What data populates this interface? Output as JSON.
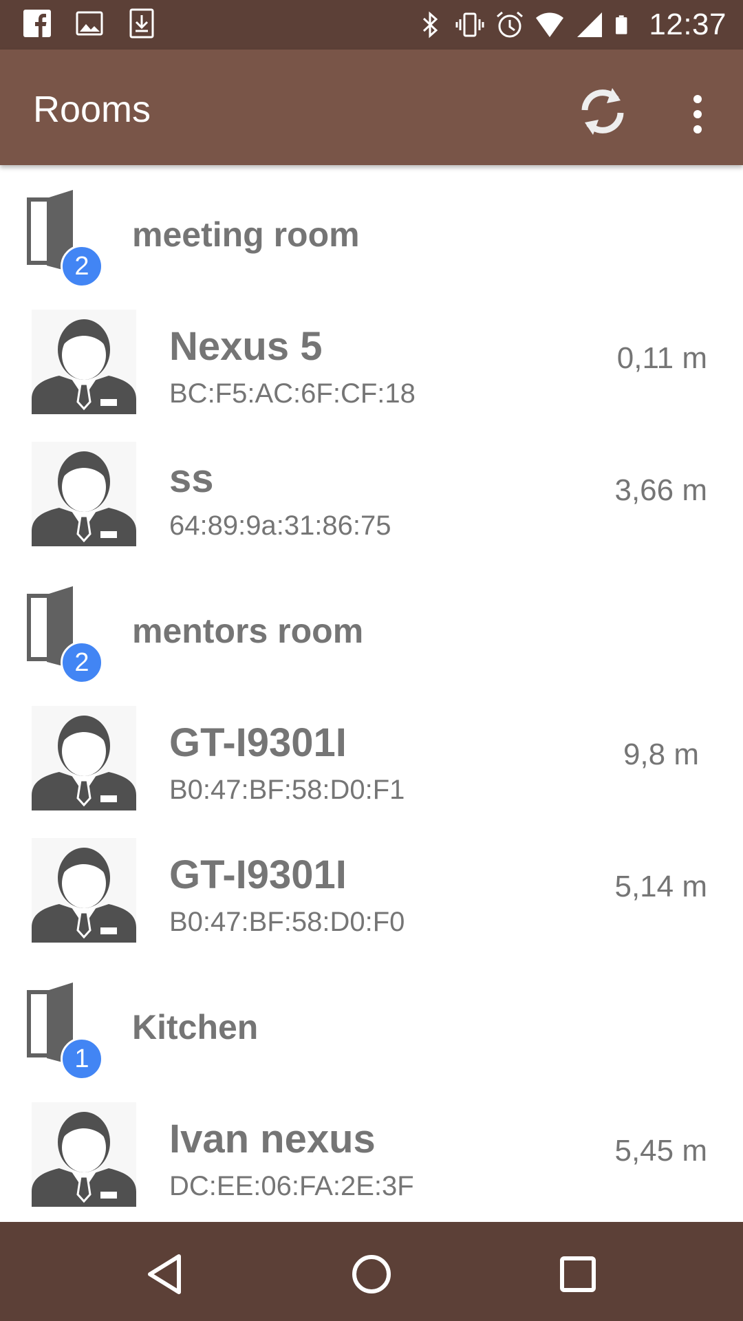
{
  "status_bar": {
    "icons_left": [
      "facebook-icon",
      "image-icon",
      "download-icon"
    ],
    "icons_right": [
      "bluetooth-icon",
      "vibrate-icon",
      "alarm-icon",
      "wifi-icon",
      "signal-icon",
      "battery-icon"
    ],
    "time": "12:37"
  },
  "app_bar": {
    "title": "Rooms",
    "actions": [
      "refresh-icon",
      "overflow-menu-icon"
    ],
    "background": "#795548"
  },
  "rooms": [
    {
      "name": "meeting room",
      "count": "2",
      "devices": [
        {
          "name": "Nexus 5",
          "mac": "BC:F5:AC:6F:CF:18",
          "distance": "0,11 m"
        },
        {
          "name": "ss",
          "mac": "64:89:9a:31:86:75",
          "distance": "3,66 m"
        }
      ]
    },
    {
      "name": "mentors room",
      "count": "2",
      "devices": [
        {
          "name": "GT-I9301I",
          "mac": "B0:47:BF:58:D0:F1",
          "distance": "9,8 m"
        },
        {
          "name": "GT-I9301I",
          "mac": "B0:47:BF:58:D0:F0",
          "distance": "5,14 m"
        }
      ]
    },
    {
      "name": "Kitchen",
      "count": "1",
      "devices": [
        {
          "name": "Ivan nexus",
          "mac": "DC:EE:06:FA:2E:3F",
          "distance": "5,45 m"
        }
      ]
    }
  ],
  "nav_bar": {
    "buttons": [
      "back-icon",
      "home-icon",
      "recents-icon"
    ]
  },
  "colors": {
    "status_bar": "#5c4037",
    "app_bar": "#795548",
    "badge": "#4285f4",
    "text": "#757575"
  }
}
